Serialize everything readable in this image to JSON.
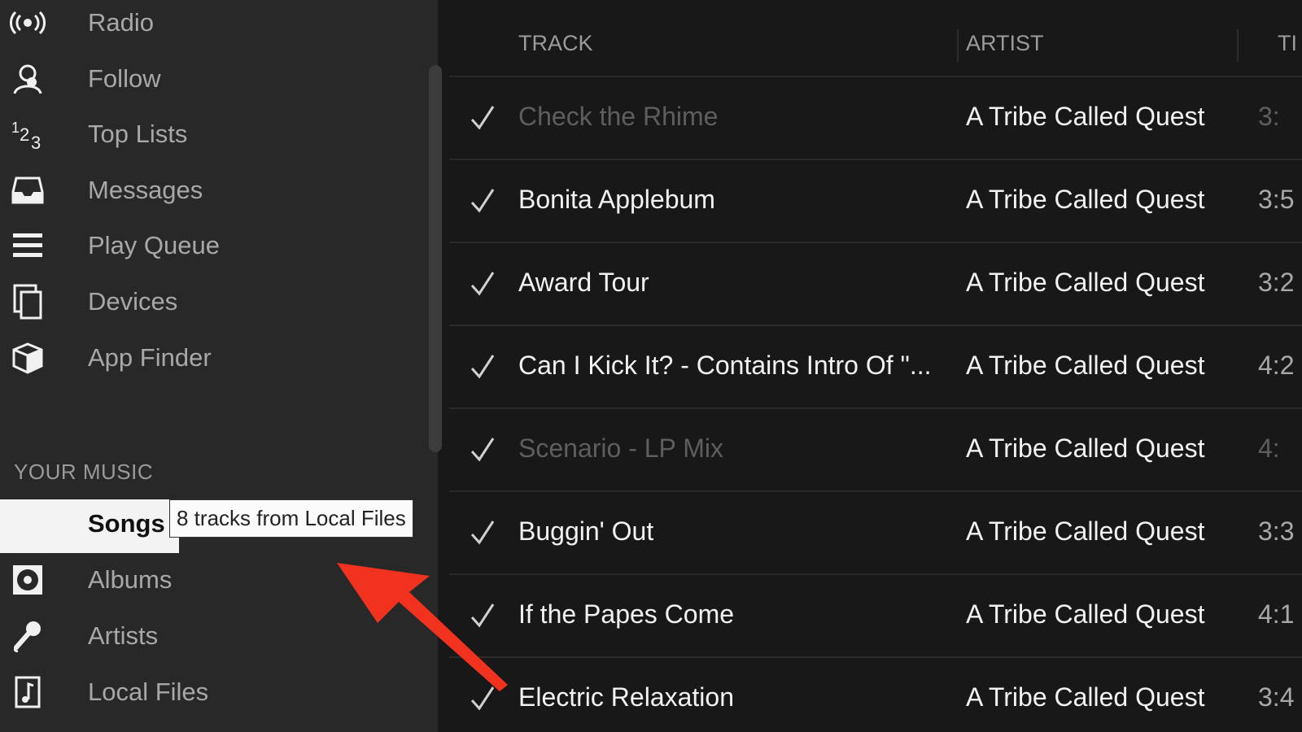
{
  "sidebar": {
    "items": [
      {
        "label": "Radio",
        "icon": "radio-icon"
      },
      {
        "label": "Follow",
        "icon": "follow-icon"
      },
      {
        "label": "Top Lists",
        "icon": "top-lists-icon"
      },
      {
        "label": "Messages",
        "icon": "inbox-icon"
      },
      {
        "label": "Play Queue",
        "icon": "queue-icon"
      },
      {
        "label": "Devices",
        "icon": "devices-icon"
      },
      {
        "label": "App Finder",
        "icon": "app-finder-icon"
      }
    ],
    "section_title": "YOUR MUSIC",
    "music_items": [
      {
        "label": "Songs",
        "selected": true
      },
      {
        "label": "Albums",
        "icon": "album-icon"
      },
      {
        "label": "Artists",
        "icon": "microphone-icon"
      },
      {
        "label": "Local Files",
        "icon": "music-file-icon"
      }
    ],
    "tooltip": "8 tracks from Local Files"
  },
  "tracklist": {
    "columns": [
      "TRACK",
      "ARTIST",
      "TI"
    ],
    "rows": [
      {
        "track": "Check the Rhime",
        "artist": "A Tribe Called Quest",
        "time": "3:",
        "unavailable": true
      },
      {
        "track": "Bonita Applebum",
        "artist": "A Tribe Called Quest",
        "time": "3:5",
        "unavailable": false
      },
      {
        "track": "Award Tour",
        "artist": "A Tribe Called Quest",
        "time": "3:2",
        "unavailable": false
      },
      {
        "track": "Can I Kick It? - Contains Intro Of \"...",
        "artist": "A Tribe Called Quest",
        "time": "4:2",
        "unavailable": false
      },
      {
        "track": "Scenario - LP Mix",
        "artist": "A Tribe Called Quest",
        "time": "4:",
        "unavailable": true
      },
      {
        "track": "Buggin' Out",
        "artist": "A Tribe Called Quest",
        "time": "3:3",
        "unavailable": false
      },
      {
        "track": "If the Papes Come",
        "artist": "A Tribe Called Quest",
        "time": "4:1",
        "unavailable": false
      },
      {
        "track": "Electric Relaxation",
        "artist": "A Tribe Called Quest",
        "time": "3:4",
        "unavailable": false
      }
    ]
  },
  "colors": {
    "sidebar_bg": "#282828",
    "main_bg": "#181818",
    "annotation_arrow": "#f0321e"
  }
}
